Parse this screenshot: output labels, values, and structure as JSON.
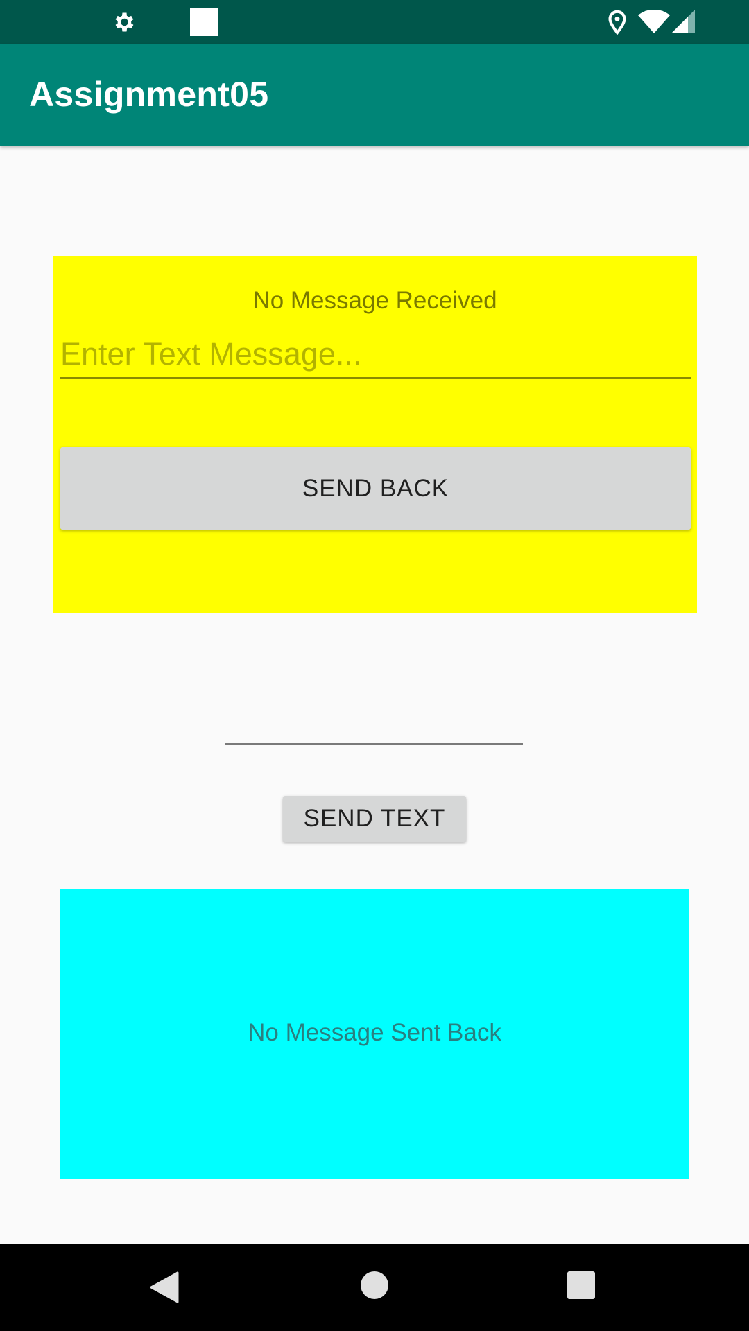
{
  "status_bar": {
    "icons": [
      "gear-icon",
      "square-notification-icon",
      "location-icon",
      "wifi-icon",
      "signal-icon"
    ],
    "color": "#00574b"
  },
  "app_bar": {
    "title": "Assignment05",
    "color": "#008577"
  },
  "top_fragment": {
    "background": "#ffff00",
    "received_label": "No Message Received",
    "input_placeholder": "Enter Text Message...",
    "input_value": "",
    "button_label": "SEND BACK"
  },
  "middle": {
    "input_value": "",
    "button_label": "SEND TEXT"
  },
  "bottom_fragment": {
    "background": "#00ffff",
    "sent_back_label": "No Message Sent Back"
  },
  "nav_bar": {
    "icons": [
      "back-icon",
      "home-icon",
      "recents-icon"
    ]
  }
}
